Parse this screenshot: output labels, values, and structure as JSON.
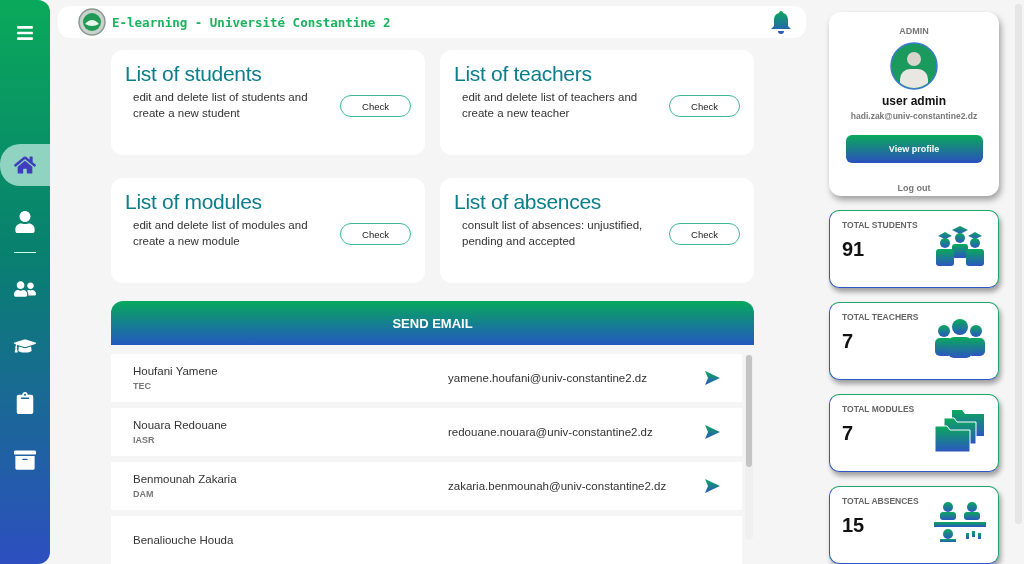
{
  "sidebar": {
    "items": [
      {
        "kind": "home",
        "selected": true
      },
      {
        "kind": "user",
        "selected": false
      },
      {
        "kind": "users",
        "selected": false
      },
      {
        "kind": "graduation",
        "selected": false
      },
      {
        "kind": "clipboard",
        "selected": false
      },
      {
        "kind": "archive",
        "selected": false
      }
    ]
  },
  "header": {
    "title": "E-learning - Université Constantine 2"
  },
  "cards": [
    {
      "title": "List of students",
      "description": "edit and delete list of students and create a new student",
      "button": "Check"
    },
    {
      "title": "List of teachers",
      "description": "edit and delete list of teachers and create a new teacher",
      "button": "Check"
    },
    {
      "title": "List of modules",
      "description": "edit and delete list of modules and create a new module",
      "button": "Check"
    },
    {
      "title": "List of absences",
      "description": "consult list of absences: unjustified, pending and accepted",
      "button": "Check"
    }
  ],
  "send_email": {
    "title": "SEND EMAIL",
    "recipients": [
      {
        "name": "Houfani Yamene",
        "department": "TEC",
        "email": "yamene.houfani@univ-constantine2.dz"
      },
      {
        "name": "Nouara Redouane",
        "department": "IASR",
        "email": "redouane.nouara@univ-constantine2.dz"
      },
      {
        "name": "Benmounah Zakaria",
        "department": "DAM",
        "email": "zakaria.benmounah@univ-constantine2.dz"
      },
      {
        "name": "Benaliouche Houda"
      }
    ]
  },
  "profile": {
    "role": "ADMIN",
    "name": "user admin",
    "email": "hadi.zak@univ-constantine2.dz",
    "view_button": "View profile",
    "logout": "Log out"
  },
  "stats": [
    {
      "kind": "students",
      "label": "TOTAL STUDENTS",
      "value": "91"
    },
    {
      "kind": "teachers",
      "label": "TOTAL TEACHERS",
      "value": "7"
    },
    {
      "kind": "modules",
      "label": "TOTAL MODULES",
      "value": "7"
    },
    {
      "kind": "absences",
      "label": "TOTAL ABSENCES",
      "value": "15"
    }
  ]
}
